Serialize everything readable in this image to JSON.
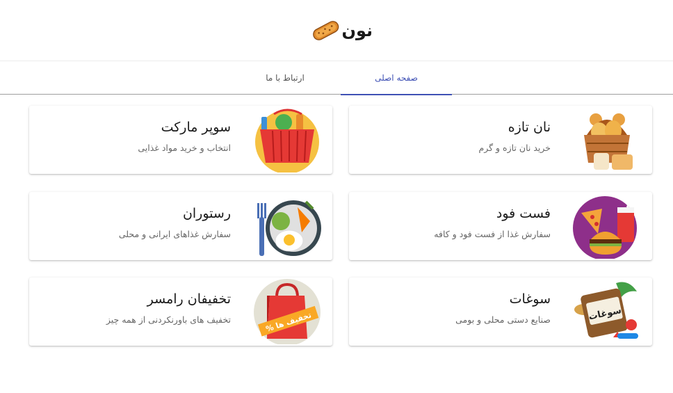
{
  "app": {
    "logo_text": "نون"
  },
  "tabs": [
    {
      "label": "صفحه اصلی",
      "active": true
    },
    {
      "label": "ارتباط با ما",
      "active": false
    }
  ],
  "colors": {
    "accent": "#3f51b5"
  },
  "cards": [
    {
      "title": "نان تازه",
      "subtitle": "خرید نان تازه و گرم",
      "icon": "bread-basket-icon"
    },
    {
      "title": "سوپر مارکت",
      "subtitle": "انتخاب و خرید مواد غذایی",
      "icon": "grocery-basket-icon"
    },
    {
      "title": "فست فود",
      "subtitle": "سفارش غذا از فست فود و کافه",
      "icon": "fast-food-icon"
    },
    {
      "title": "رستوران",
      "subtitle": "سفارش غذاهای ایرانی و محلی",
      "icon": "restaurant-plate-icon"
    },
    {
      "title": "سوغات",
      "subtitle": "صنایع دستی محلی و بومی",
      "icon": "souvenir-suitcase-icon",
      "icon_text": "سوغات"
    },
    {
      "title": "تخفیفان رامسر",
      "subtitle": "تخفیف های باورنکردنی از همه چیز",
      "icon": "discount-bag-icon",
      "icon_text": "% تخفیف ها"
    }
  ]
}
